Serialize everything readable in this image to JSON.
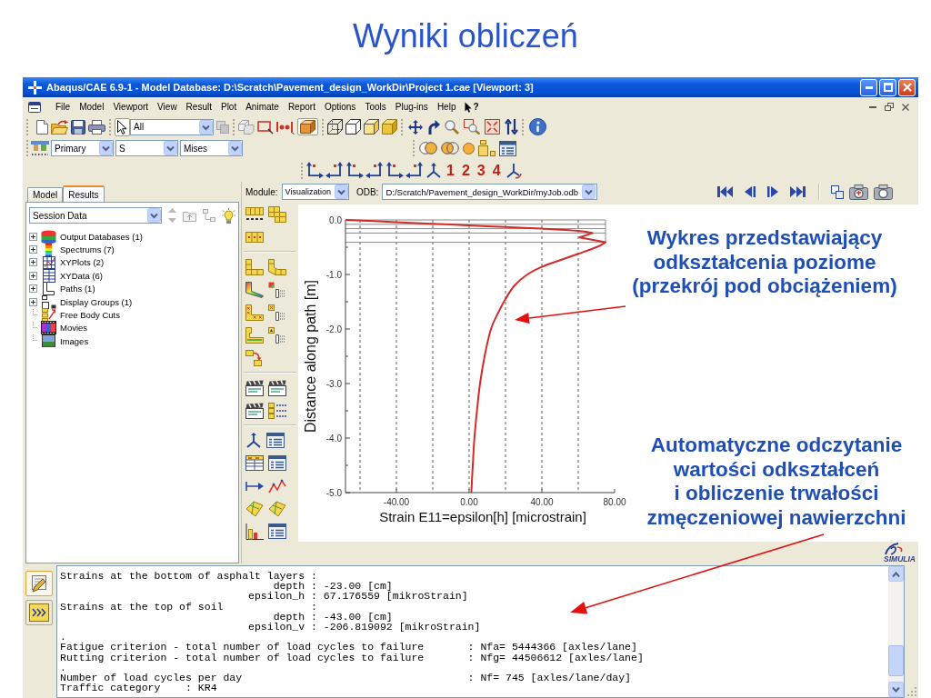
{
  "slide": {
    "title": "Wyniki obliczeń"
  },
  "window": {
    "title": "Abaqus/CAE 6.9-1 - Model Database: D:\\Scratch\\Pavement_design_WorkDir\\Project 1.cae [Viewport: 3]"
  },
  "menu_bar": {
    "items": [
      "File",
      "Model",
      "Viewport",
      "View",
      "Result",
      "Plot",
      "Animate",
      "Report",
      "Options",
      "Tools",
      "Plug-ins",
      "Help"
    ],
    "whats_this": "?"
  },
  "toolbar": {
    "select_button": {
      "selected": true
    },
    "selection_filter": "All",
    "shaded_box_button": {
      "selected": true
    },
    "field_output": [
      "Primary",
      "S",
      "Mises"
    ],
    "view_buttons": [
      "1",
      "2",
      "3",
      "4"
    ]
  },
  "left_panel": {
    "tabs": [
      {
        "label": "Model",
        "selected": false
      },
      {
        "label": "Results",
        "selected": true
      }
    ],
    "tree_selector": "Session Data",
    "tree": [
      {
        "label": "Output Databases (1)",
        "expandable": true
      },
      {
        "label": "Spectrums (7)",
        "expandable": true
      },
      {
        "label": "XYPlots (2)",
        "expandable": true
      },
      {
        "label": "XYData (6)",
        "expandable": true
      },
      {
        "label": "Paths (1)",
        "expandable": true
      },
      {
        "label": "Display Groups (1)",
        "expandable": true
      },
      {
        "label": "Free Body Cuts",
        "expandable": false
      },
      {
        "label": "Movies",
        "expandable": false
      },
      {
        "label": "Images",
        "expandable": false
      }
    ]
  },
  "context_bar": {
    "module_label": "Module:",
    "module": "Visualization",
    "odb_label": "ODB:",
    "odb": "D:/Scratch/Pavement_design_WorkDir/myJob.odb"
  },
  "viewport": {
    "chart_data": {
      "type": "line",
      "xlabel": "Strain E11=epsilon[h] [microstrain]",
      "ylabel": "Distance along path [m]",
      "x": [
        -68,
        -40,
        -20,
        0,
        20,
        40,
        60,
        67.9,
        60.7,
        75,
        70,
        60,
        49,
        40,
        32,
        25,
        20,
        16,
        12,
        8.5,
        6,
        4.3,
        2.9,
        2,
        1.2
      ],
      "series": [
        {
          "color": "#d42a2a",
          "values": [
            0,
            -0.04,
            -0.07,
            -0.1,
            -0.13,
            -0.16,
            -0.2,
            -0.24,
            -0.32,
            -0.41,
            -0.5,
            -0.62,
            -0.75,
            -0.86,
            -1.0,
            -1.2,
            -1.45,
            -1.7,
            -2.0,
            -2.5,
            -3.0,
            -3.5,
            -4.0,
            -4.5,
            -5.0
          ]
        }
      ],
      "xlim": [
        -68,
        80
      ],
      "ylim": [
        -5,
        0
      ],
      "xticks": [
        {
          "value": -40,
          "label": "-40.00"
        },
        {
          "value": 0,
          "label": "0.00"
        },
        {
          "value": 40,
          "label": "40.00"
        },
        {
          "value": 80,
          "label": "80.00"
        }
      ],
      "yticks": [
        {
          "value": 0,
          "label": "0.0"
        },
        {
          "value": -1,
          "label": "-1.0"
        },
        {
          "value": -2,
          "label": "-2.0"
        },
        {
          "value": -3,
          "label": "-3.0"
        },
        {
          "value": -4,
          "label": "-4.0"
        },
        {
          "value": -5,
          "label": "-5.0"
        }
      ],
      "grid": true
    },
    "annotations": [
      {
        "lines": [
          "Wykres przedstawiający",
          "odkształcenia poziome",
          "(przekrój pod obciążeniem)"
        ]
      },
      {
        "lines": [
          "Automatyczne odczytanie",
          "wartości odkształceń",
          "i obliczenie trwałości",
          "zmęczeniowej nawierzchni"
        ]
      }
    ],
    "logo": "SIMULIA"
  },
  "console": {
    "tabs": [
      {
        "kind": "messages",
        "selected": true
      },
      {
        "kind": "python",
        "selected": false
      }
    ],
    "lines": [
      "Strains at the bottom of asphalt layers :",
      "                                  depth : -23.00 [cm]",
      "                              epsilon_h : 67.176559 [mikroStrain]",
      "Strains at the top of soil              :",
      "                                  depth : -43.00 [cm]",
      "                              epsilon_v : -206.819092 [mikroStrain]",
      ".",
      "Fatigue criterion - total number of load cycles to failure       : Nfa= 5444366 [axles/lane]",
      "Rutting criterion - total number of load cycles to failure       : Nfg= 44506612 [axles/lane]",
      ".",
      "Number of load cycles per day                                    : Nf= 745 [axles/lane/day]",
      "Traffic category    : KR4"
    ]
  }
}
